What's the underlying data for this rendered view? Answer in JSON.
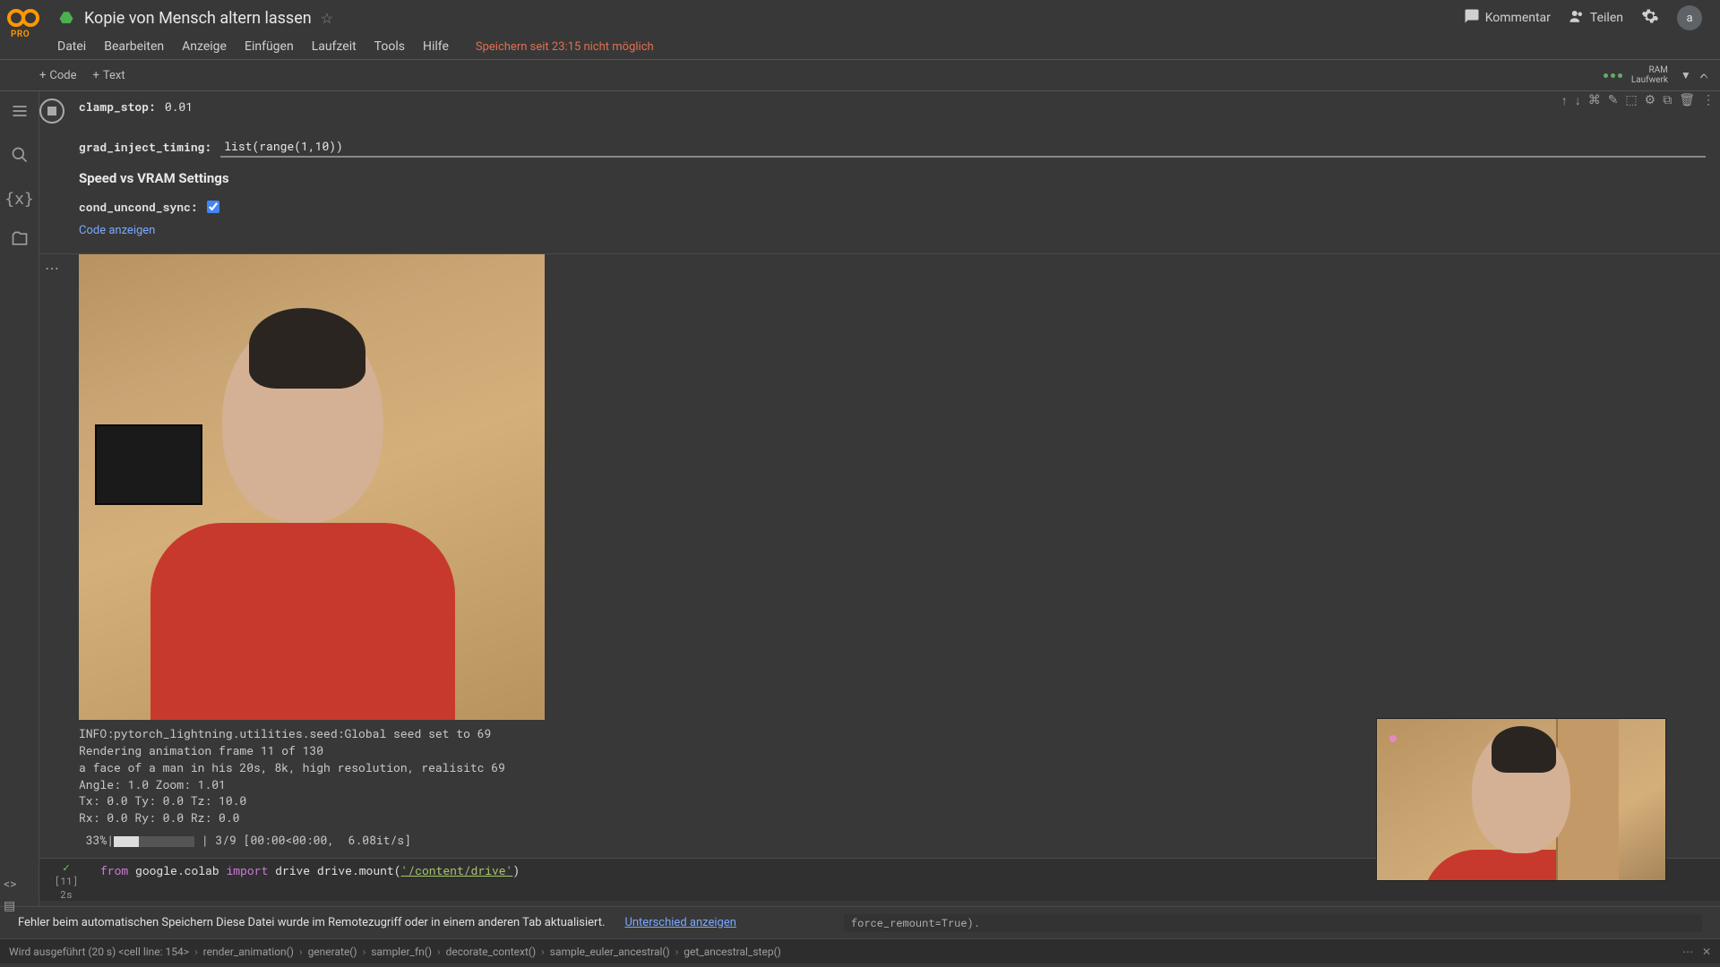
{
  "header": {
    "pro_label": "PRO",
    "title": "Kopie von Mensch altern lassen",
    "comment_label": "Kommentar",
    "share_label": "Teilen",
    "avatar_letter": "a"
  },
  "menubar": {
    "items": [
      "Datei",
      "Bearbeiten",
      "Anzeige",
      "Einfügen",
      "Laufzeit",
      "Tools",
      "Hilfe"
    ],
    "save_warning": "Speichern seit 23:15 nicht möglich"
  },
  "toolbar": {
    "add_code": "Code",
    "add_text": "Text",
    "ram_label": "RAM",
    "disk_label": "Laufwerk"
  },
  "cell": {
    "clamp_stop_label": "clamp_stop:",
    "clamp_stop_value": "0.01",
    "grad_label": "grad_inject_timing:",
    "grad_value": "list(range(1,10))",
    "section_heading": "Speed vs VRAM Settings",
    "cond_label": "cond_uncond_sync:",
    "cond_checked": true,
    "show_code": "Code anzeigen"
  },
  "output_log": "INFO:pytorch_lightning.utilities.seed:Global seed set to 69\nRendering animation frame 11 of 130\na face of a man in his 20s, 8k, high resolution, realisitc 69\nAngle: 1.0 Zoom: 1.01\nTx: 0.0 Ty: 0.0 Tz: 10.0\nRx: 0.0 Ry: 0.0 Rz: 0.0",
  "progress": {
    "percent": "33%",
    "bar_done_chars": 3,
    "bar_total_chars": 12,
    "suffix": "| 3/9 [00:00<00:00,  6.08it/s]"
  },
  "code_cell": {
    "prompt": "[11]",
    "exec_count": "2s",
    "kw_from": "from",
    "mod1": "google.colab",
    "kw_import": "import",
    "mod2": "drive",
    "line2_prefix": "drive.mount(",
    "line2_str": "'/content/drive'",
    "line2_suffix": ")",
    "output_frag": "force_remount=True)."
  },
  "warn_bar": {
    "text": "Fehler beim automatischen Speichern Diese Datei wurde im Remotezugriff oder in einem anderen Tab aktualisiert.",
    "link": "Unterschied anzeigen"
  },
  "breadcrumb": {
    "prefix": "Wird ausgeführt (20 s)  <cell line: 154>",
    "items": [
      "render_animation()",
      "generate()",
      "sampler_fn()",
      "decorate_context()",
      "sample_euler_ancestral()",
      "get_ancestral_step()"
    ]
  }
}
